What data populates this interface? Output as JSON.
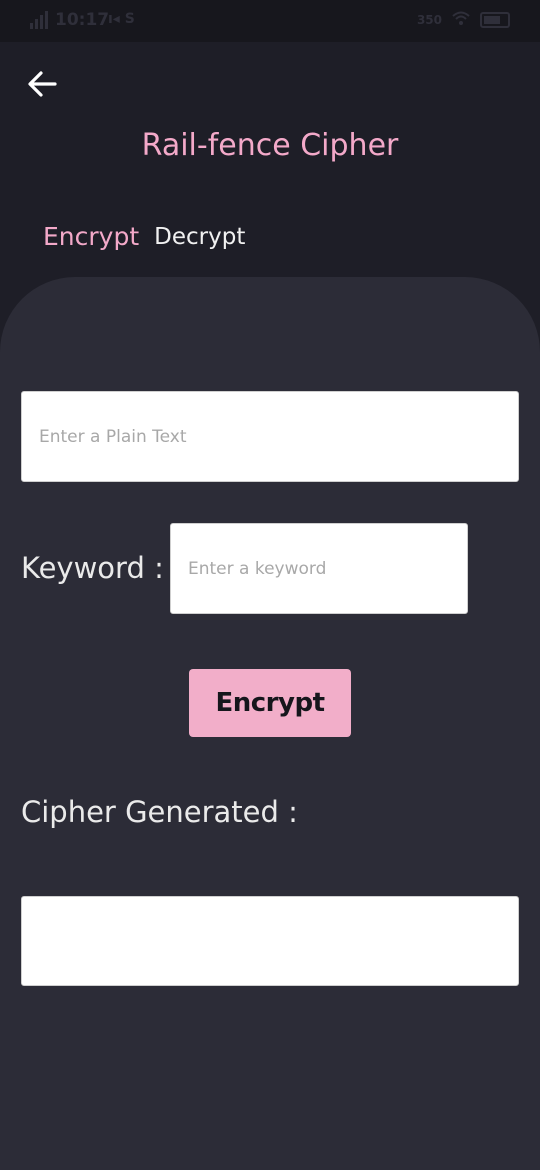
{
  "status_bar": {
    "time": "10:17",
    "mini_icons": "ı◂ S",
    "network_label": "350",
    "battery_icon": "battery-icon"
  },
  "header": {
    "back_icon": "arrow-left-icon",
    "title": "Rail-fence Cipher"
  },
  "tabs": {
    "encrypt": "Encrypt",
    "decrypt": "Decrypt"
  },
  "form": {
    "plain_text_placeholder": "Enter a Plain Text",
    "plain_text_value": "",
    "keyword_label": "Keyword :",
    "keyword_placeholder": "Enter a keyword",
    "keyword_value": "",
    "encrypt_button": "Encrypt",
    "cipher_label": "Cipher Generated :",
    "cipher_value": ""
  },
  "colors": {
    "accent": "#f3a9c9",
    "background": "#1e1e27",
    "card": "#2c2c37",
    "button": "#f2aec9"
  }
}
